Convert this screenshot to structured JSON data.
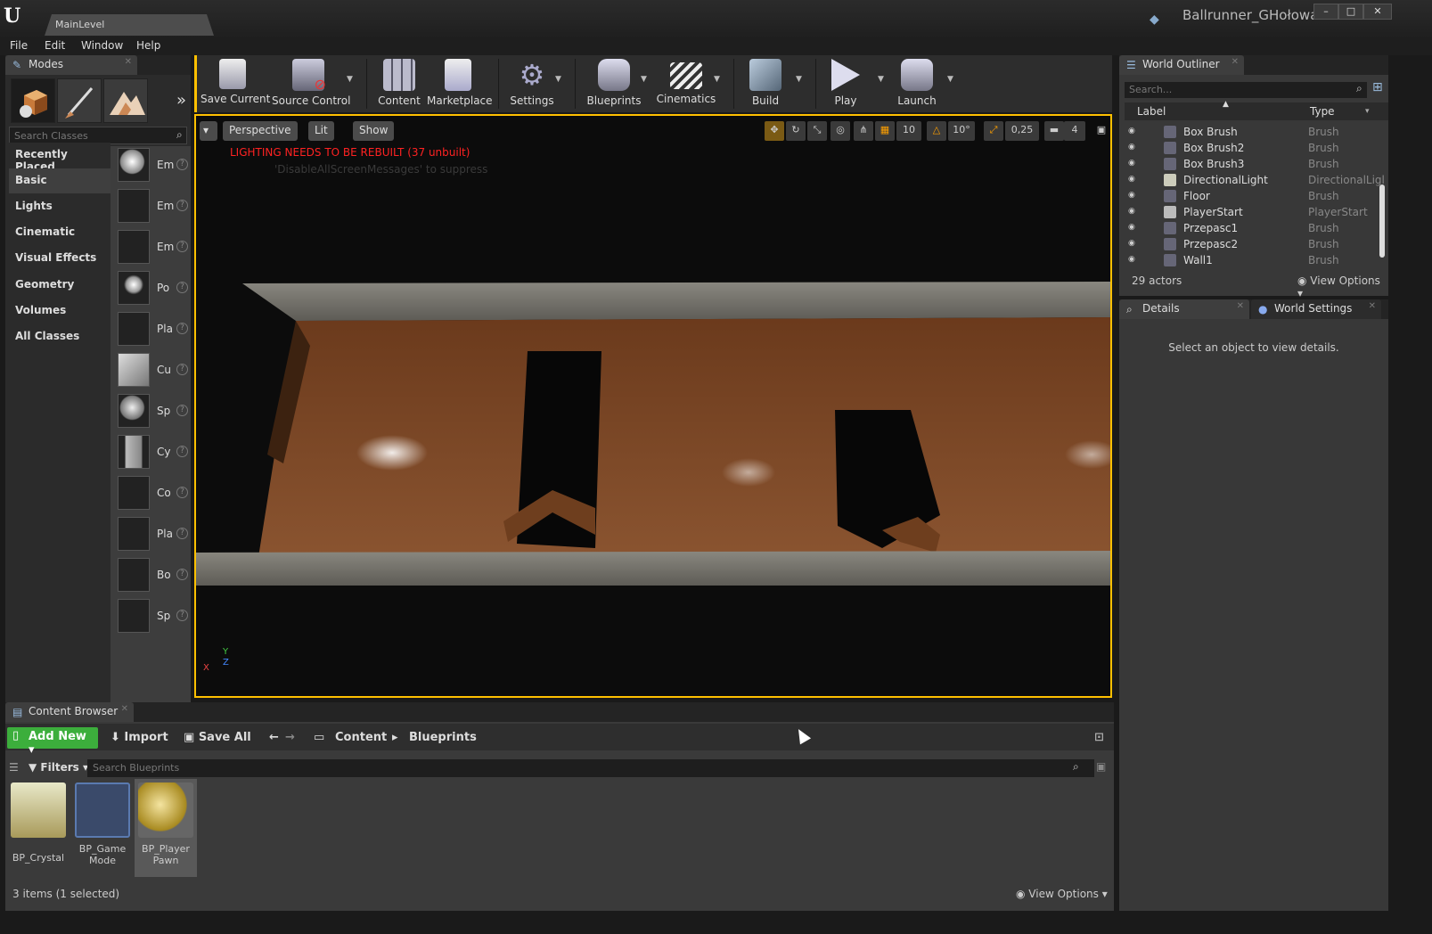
{
  "window": {
    "level_tab": "MainLevel",
    "project_name": "Ballrunner_GHołowacz",
    "controls": [
      "–",
      "□",
      "✕"
    ]
  },
  "menu": [
    "File",
    "Edit",
    "Window",
    "Help"
  ],
  "modes": {
    "tab_label": "Modes",
    "search_placeholder": "Search Classes",
    "categories": [
      "Recently Placed",
      "Basic",
      "Lights",
      "Cinematic",
      "Visual Effects",
      "Geometry",
      "Volumes",
      "All Classes"
    ],
    "active_category": "Basic",
    "classes": [
      "Em",
      "Em",
      "Em",
      "Po",
      "Pla",
      "Cu",
      "Sp",
      "Cy",
      "Co",
      "Pla",
      "Bo",
      "Sp"
    ]
  },
  "toolbar": {
    "buttons": [
      {
        "label": "Save Current",
        "icon": "save-icon"
      },
      {
        "label": "Source Control",
        "icon": "source-control-icon"
      },
      {
        "label": "Content",
        "icon": "content-icon"
      },
      {
        "label": "Marketplace",
        "icon": "marketplace-icon"
      },
      {
        "label": "Settings",
        "icon": "settings-icon"
      },
      {
        "label": "Blueprints",
        "icon": "blueprints-icon"
      },
      {
        "label": "Cinematics",
        "icon": "cinematics-icon"
      },
      {
        "label": "Build",
        "icon": "build-icon"
      },
      {
        "label": "Play",
        "icon": "play-icon"
      },
      {
        "label": "Launch",
        "icon": "launch-icon"
      }
    ]
  },
  "viewport": {
    "perspective_label": "Perspective",
    "lit_label": "Lit",
    "show_label": "Show",
    "lighting_warning": "LIGHTING NEEDS TO BE REBUILT (37 unbuilt)",
    "suppress_message": "'DisableAllScreenMessages' to suppress",
    "grid_snap": "10",
    "rotation_snap": "10°",
    "scale_snap": "0,25",
    "camera_speed": "4",
    "axis_x": "X",
    "axis_y": "Y",
    "axis_z": "Z"
  },
  "world_outliner": {
    "tab_label": "World Outliner",
    "search_placeholder": "Search...",
    "columns": {
      "label": "Label",
      "type": "Type"
    },
    "rows": [
      {
        "name": "Box Brush",
        "type": "Brush"
      },
      {
        "name": "Box Brush2",
        "type": "Brush"
      },
      {
        "name": "Box Brush3",
        "type": "Brush"
      },
      {
        "name": "DirectionalLight",
        "type": "DirectionalLigl"
      },
      {
        "name": "Floor",
        "type": "Brush"
      },
      {
        "name": "PlayerStart",
        "type": "PlayerStart"
      },
      {
        "name": "Przepasc1",
        "type": "Brush"
      },
      {
        "name": "Przepasc2",
        "type": "Brush"
      },
      {
        "name": "Wall1",
        "type": "Brush"
      }
    ],
    "actor_count": "29 actors",
    "view_options": "View Options"
  },
  "details": {
    "tab_label": "Details",
    "world_settings_label": "World Settings",
    "empty_message": "Select an object to view details."
  },
  "content_browser": {
    "tab_label": "Content Browser",
    "add_new": "Add New",
    "import": "Import",
    "save_all": "Save All",
    "path": [
      "Content",
      "Blueprints"
    ],
    "filters": "Filters",
    "search_placeholder": "Search Blueprints",
    "assets": [
      {
        "name": "BP_Crystal",
        "selected": false
      },
      {
        "name": "BP_Game Mode",
        "selected": false
      },
      {
        "name": "BP_Player Pawn",
        "selected": true
      }
    ],
    "status": "3 items (1 selected)",
    "view_options": "View Options"
  },
  "colors": {
    "accent": "#ffc000",
    "add_new": "#3cae3c",
    "warning": "#ff2222"
  }
}
